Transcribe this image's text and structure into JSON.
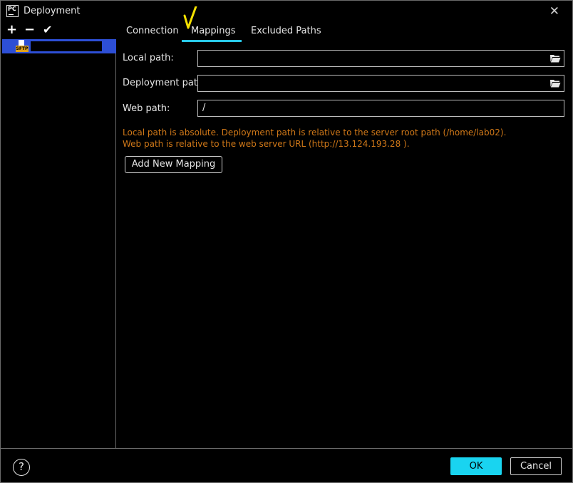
{
  "window": {
    "title": "Deployment",
    "app_badge": "PC"
  },
  "toolbar": {
    "add": "+",
    "remove": "−",
    "set_default": "✔"
  },
  "server_list": {
    "items": [
      {
        "label": "SFTP",
        "selected": true
      }
    ]
  },
  "tabs": [
    {
      "label": "Connection"
    },
    {
      "label": "Mappings",
      "active": true
    },
    {
      "label": "Excluded Paths"
    }
  ],
  "form": {
    "local_path": {
      "label": "Local path:",
      "value": ""
    },
    "deployment_path": {
      "label": "Deployment path:",
      "value": ""
    },
    "web_path": {
      "label": "Web path:",
      "value": "/"
    }
  },
  "hints": {
    "line1": "Local path is absolute. Deployment path is relative to the server root path (/home/lab02).",
    "line2": "Web path is relative to the web server URL (http://13.124.193.28 )."
  },
  "buttons": {
    "add_mapping": "Add New Mapping",
    "ok": "OK",
    "cancel": "Cancel",
    "help": "?"
  },
  "colors": {
    "accent": "#19d4f0",
    "selection": "#2d4fd6",
    "hint": "#d07818",
    "annotation": "#f5e100"
  }
}
